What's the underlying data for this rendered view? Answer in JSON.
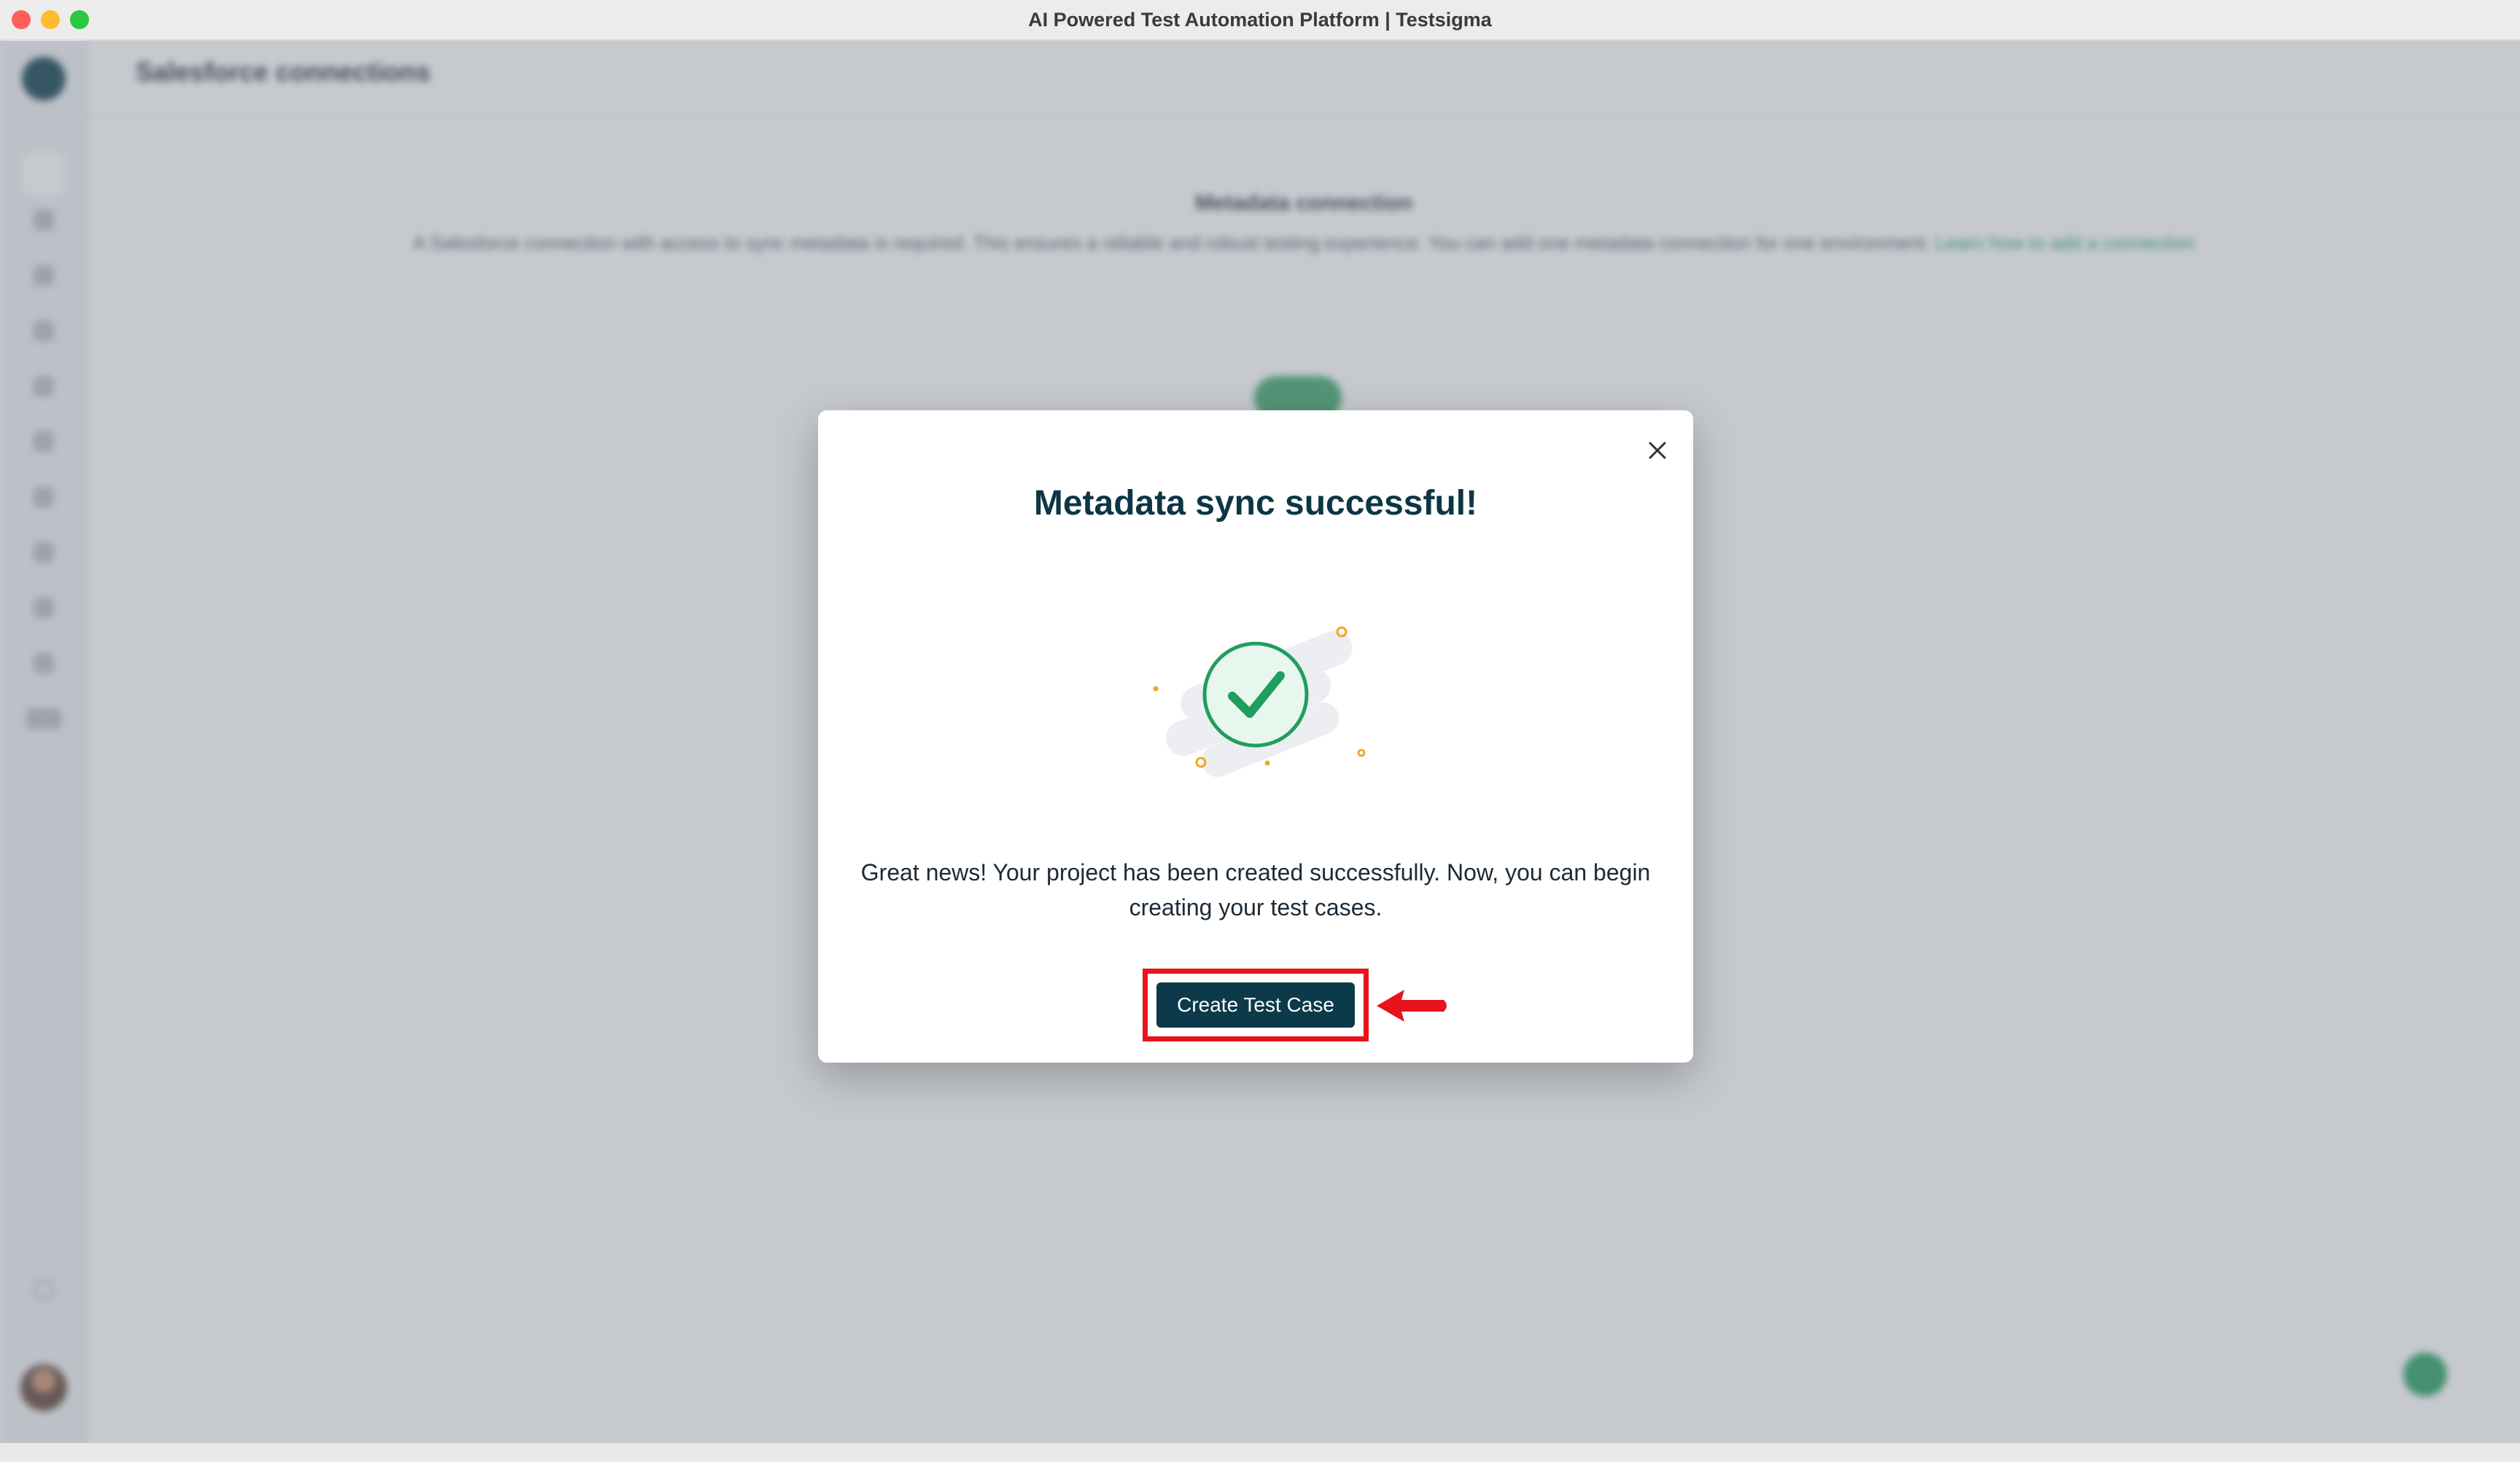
{
  "window": {
    "title": "AI Powered Test Automation Platform | Testsigma"
  },
  "page": {
    "title": "Salesforce connections",
    "section_title": "Metadata connection",
    "section_description": "A Salesforce connection with access to sync metadata is required. This ensures a reliable and robust testing experience. You can add one metadata connection for one environment.",
    "section_link": "Learn how to add a connection"
  },
  "modal": {
    "title": "Metadata sync successful!",
    "message": "Great news! Your project has been created successfully. Now, you can begin creating your test cases.",
    "primary_button": "Create Test Case",
    "close_icon": "close-icon",
    "illustration_icon": "success-check-icon"
  },
  "colors": {
    "primary": "#0d3a4a",
    "success": "#1f9e5f",
    "highlight": "#e8131b",
    "accent_dots": "#f5a524"
  }
}
